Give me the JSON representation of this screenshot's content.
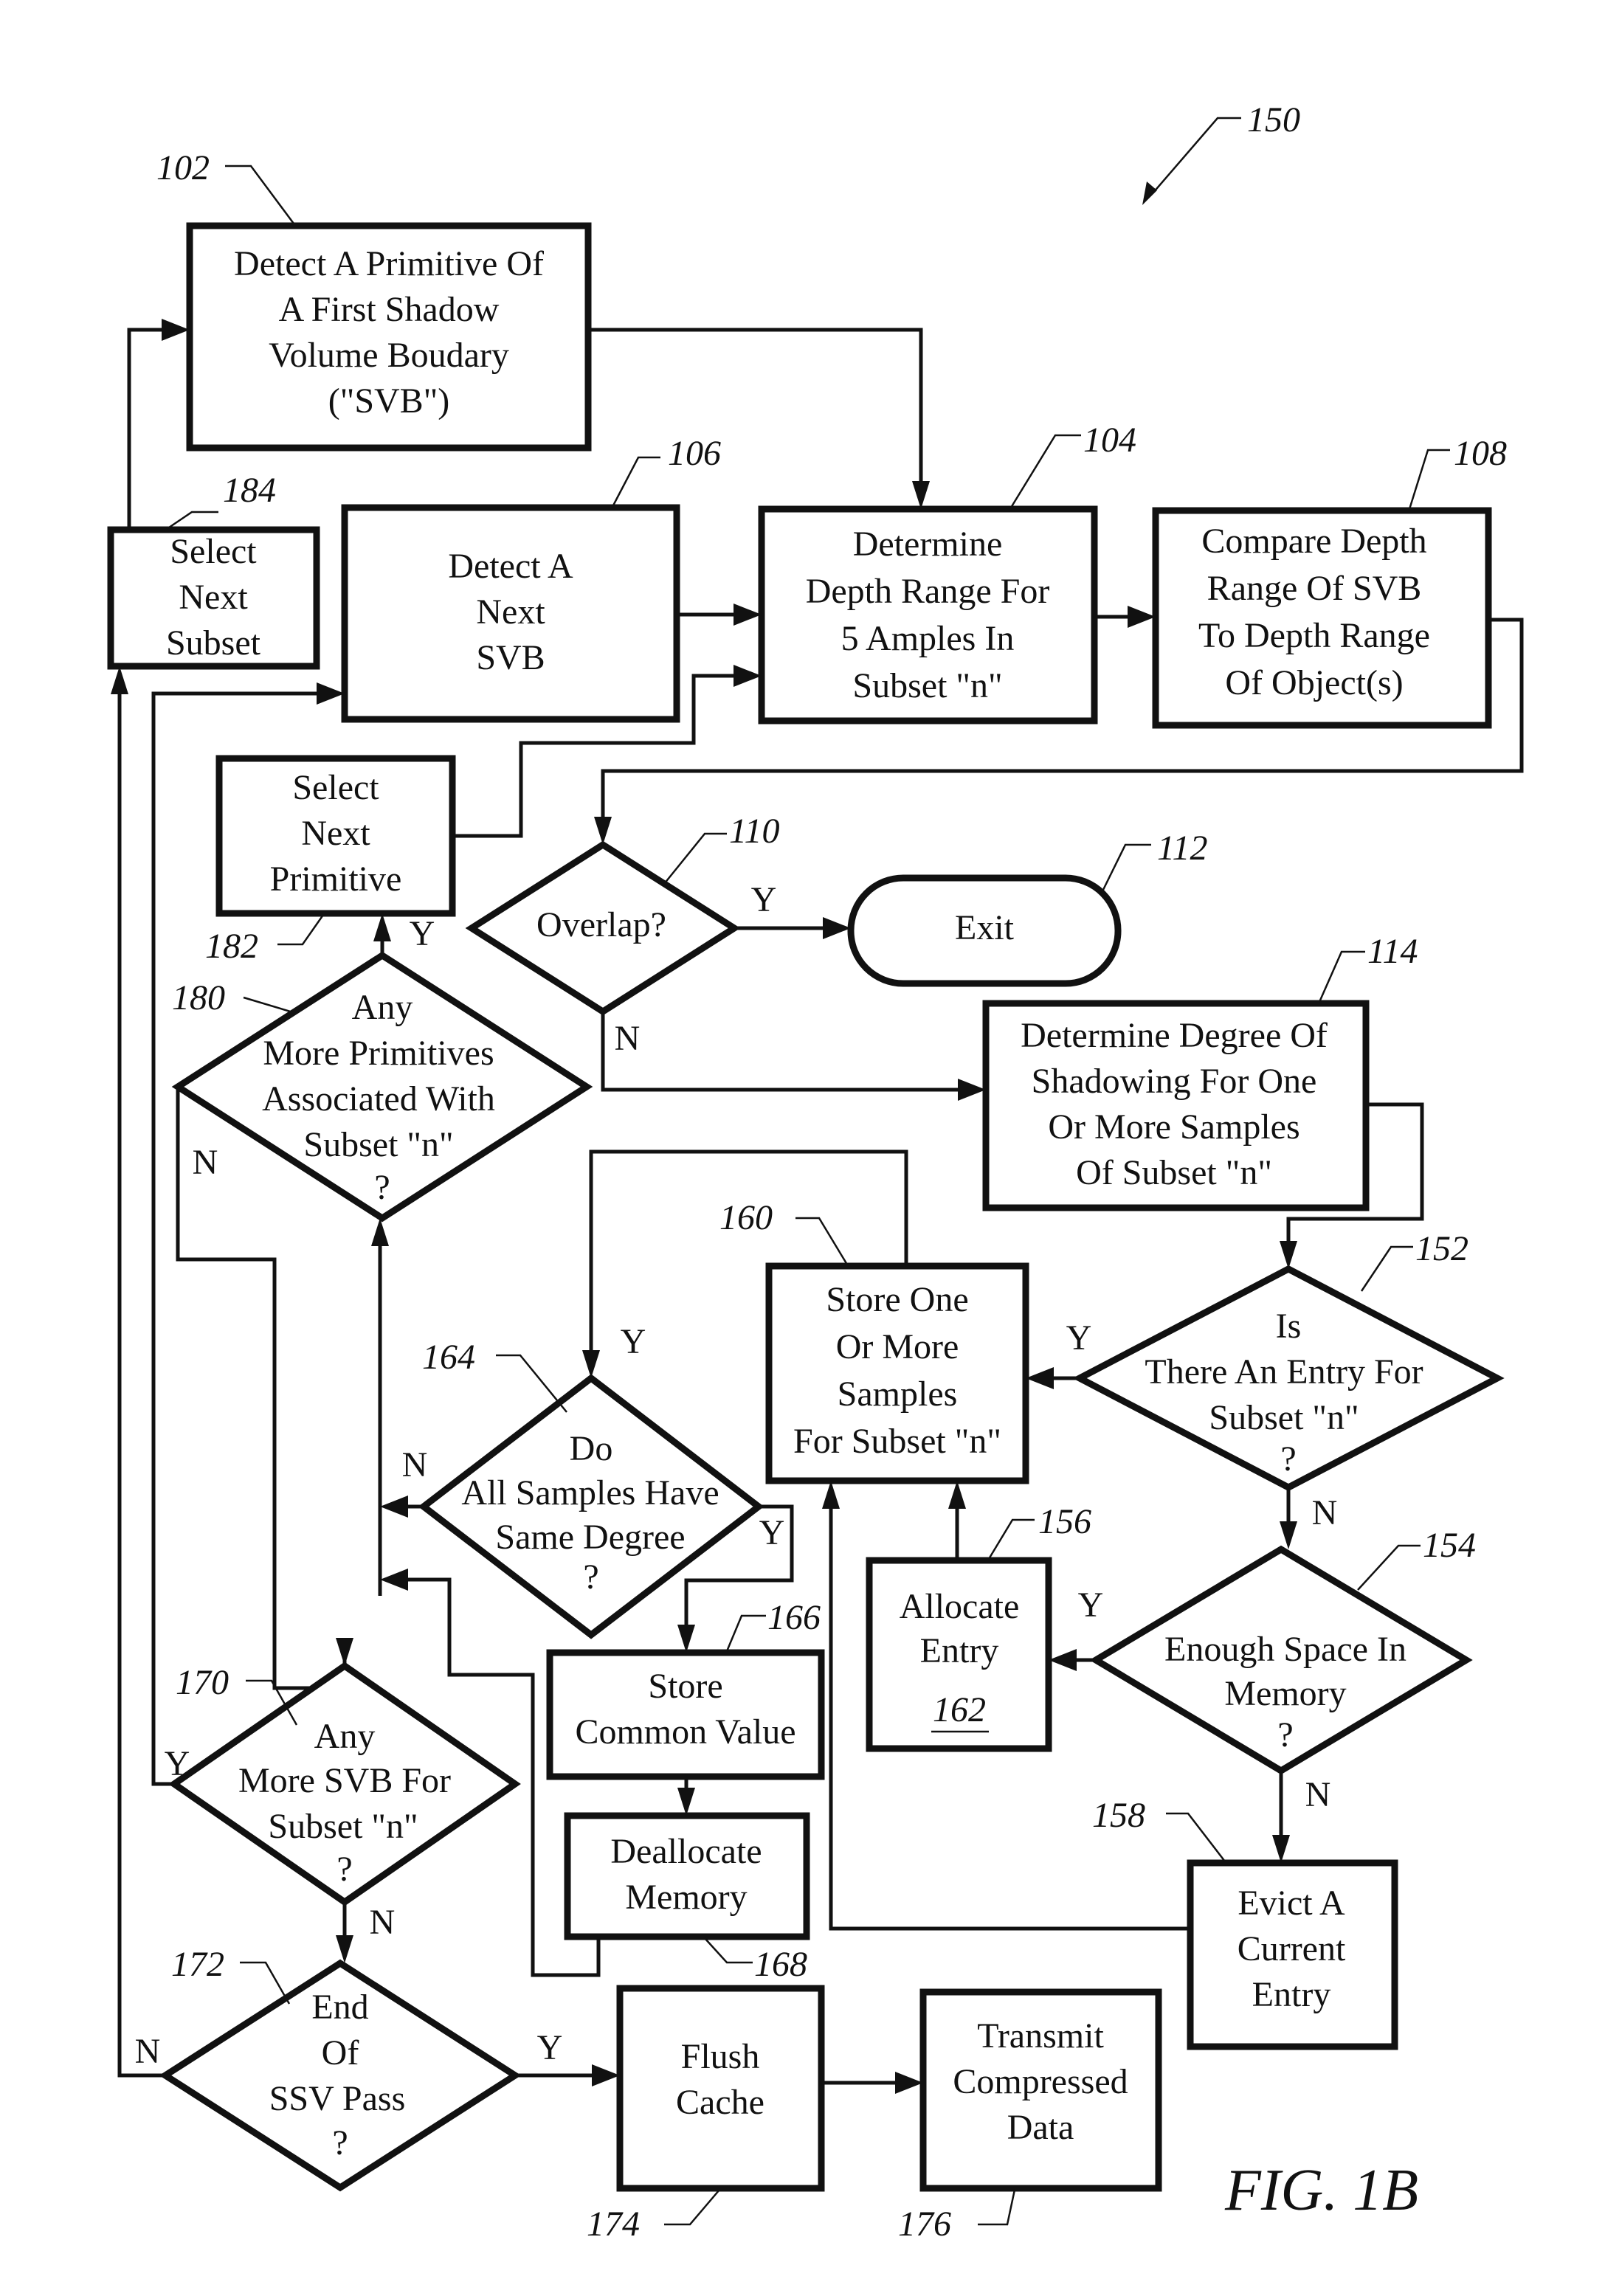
{
  "figure": {
    "label": "FIG. 1B",
    "reference": "150"
  },
  "nodes": {
    "n102": {
      "ref": "102",
      "shape": "process",
      "lines": [
        "Detect A Primitive Of",
        "A First Shadow",
        "Volume Boudary",
        "(\"SVB\")"
      ]
    },
    "n184": {
      "ref": "184",
      "shape": "process",
      "lines": [
        "Select",
        "Next",
        "Subset"
      ]
    },
    "n106": {
      "ref": "106",
      "shape": "process",
      "lines": [
        "Detect A",
        "Next",
        "SVB"
      ]
    },
    "n104": {
      "ref": "104",
      "shape": "process",
      "lines": [
        "Determine",
        "Depth Range For",
        "5 Amples In",
        "Subset \"n\""
      ]
    },
    "n108": {
      "ref": "108",
      "shape": "process",
      "lines": [
        "Compare Depth",
        "Range Of SVB",
        "To Depth Range",
        "Of Object(s)"
      ]
    },
    "n182": {
      "ref": "182",
      "shape": "process",
      "lines": [
        "Select",
        "Next",
        "Primitive"
      ]
    },
    "n110": {
      "ref": "110",
      "shape": "decision",
      "lines": [
        "Overlap?"
      ]
    },
    "n112": {
      "ref": "112",
      "shape": "terminator",
      "lines": [
        "Exit"
      ]
    },
    "n180": {
      "ref": "180",
      "shape": "decision",
      "lines": [
        "Any",
        "More Primitives",
        "Associated With",
        "Subset \"n\"",
        "?"
      ]
    },
    "n114": {
      "ref": "114",
      "shape": "process",
      "lines": [
        "Determine Degree Of",
        "Shadowing For One",
        "Or More Samples",
        "Of Subset \"n\""
      ]
    },
    "n160": {
      "ref": "160",
      "shape": "process",
      "lines": [
        "Store One",
        "Or More",
        "Samples",
        "For Subset \"n\""
      ]
    },
    "n152": {
      "ref": "152",
      "shape": "decision",
      "lines": [
        "Is",
        "There An Entry For",
        "Subset \"n\"",
        "?"
      ]
    },
    "n164": {
      "ref": "164",
      "shape": "decision",
      "lines": [
        "Do",
        "All Samples Have",
        "Same Degree",
        "?"
      ]
    },
    "n156": {
      "ref": "156",
      "shape": "process",
      "lines": [
        "Allocate",
        "Entry"
      ],
      "inner_ref": "162"
    },
    "n154": {
      "ref": "154",
      "shape": "decision",
      "lines": [
        "Enough Space In",
        "Memory",
        "?"
      ]
    },
    "n166": {
      "ref": "166",
      "shape": "process",
      "lines": [
        "Store",
        "Common Value"
      ]
    },
    "n168": {
      "ref": "168",
      "shape": "process",
      "lines": [
        "Deallocate",
        "Memory"
      ]
    },
    "n170": {
      "ref": "170",
      "shape": "decision",
      "lines": [
        "Any",
        "More SVB For",
        "Subset \"n\"",
        "?"
      ]
    },
    "n158": {
      "ref": "158",
      "shape": "process",
      "lines": [
        "Evict A",
        "Current",
        "Entry"
      ]
    },
    "n172": {
      "ref": "172",
      "shape": "decision",
      "lines": [
        "End",
        "Of",
        "SSV Pass",
        "?"
      ]
    },
    "n174": {
      "ref": "174",
      "shape": "process",
      "lines": [
        "Flush",
        "Cache"
      ]
    },
    "n176": {
      "ref": "176",
      "shape": "process",
      "lines": [
        "Transmit",
        "Compressed",
        "Data"
      ]
    }
  },
  "edge_labels": {
    "e110_yes": "Y",
    "e110_no": "N",
    "e180_yes": "Y",
    "e180_no": "N",
    "e152_yes": "Y",
    "e152_no": "N",
    "e164_yes_top": "Y",
    "e164_no": "N",
    "e164_yes": "Y",
    "e154_yes": "Y",
    "e154_no": "N",
    "e170_yes": "Y",
    "e170_no": "N",
    "e172_yes": "Y",
    "e172_no": "N"
  },
  "edges": [
    {
      "from": "102",
      "to": "104"
    },
    {
      "from": "106",
      "to": "104"
    },
    {
      "from": "182",
      "to": "104"
    },
    {
      "from": "104",
      "to": "108"
    },
    {
      "from": "108",
      "to": "110"
    },
    {
      "from": "110",
      "to": "112",
      "label": "Y"
    },
    {
      "from": "110",
      "to": "114",
      "label": "N"
    },
    {
      "from": "114",
      "to": "152"
    },
    {
      "from": "152",
      "to": "160",
      "label": "Y"
    },
    {
      "from": "152",
      "to": "154",
      "label": "N"
    },
    {
      "from": "154",
      "to": "156",
      "label": "Y"
    },
    {
      "from": "154",
      "to": "158",
      "label": "N"
    },
    {
      "from": "156",
      "to": "160"
    },
    {
      "from": "158",
      "to": "160"
    },
    {
      "from": "160",
      "to": "164",
      "label": "Y"
    },
    {
      "from": "164",
      "to": "180",
      "label": "N"
    },
    {
      "from": "164",
      "to": "166",
      "label": "Y"
    },
    {
      "from": "166",
      "to": "168"
    },
    {
      "from": "168",
      "to": "180"
    },
    {
      "from": "180",
      "to": "182",
      "label": "Y"
    },
    {
      "from": "180",
      "to": "170",
      "label": "N"
    },
    {
      "from": "170",
      "to": "106",
      "label": "Y"
    },
    {
      "from": "170",
      "to": "172",
      "label": "N"
    },
    {
      "from": "172",
      "to": "174",
      "label": "Y"
    },
    {
      "from": "172",
      "to": "184",
      "label": "N"
    },
    {
      "from": "184",
      "to": "102"
    },
    {
      "from": "174",
      "to": "176"
    }
  ]
}
